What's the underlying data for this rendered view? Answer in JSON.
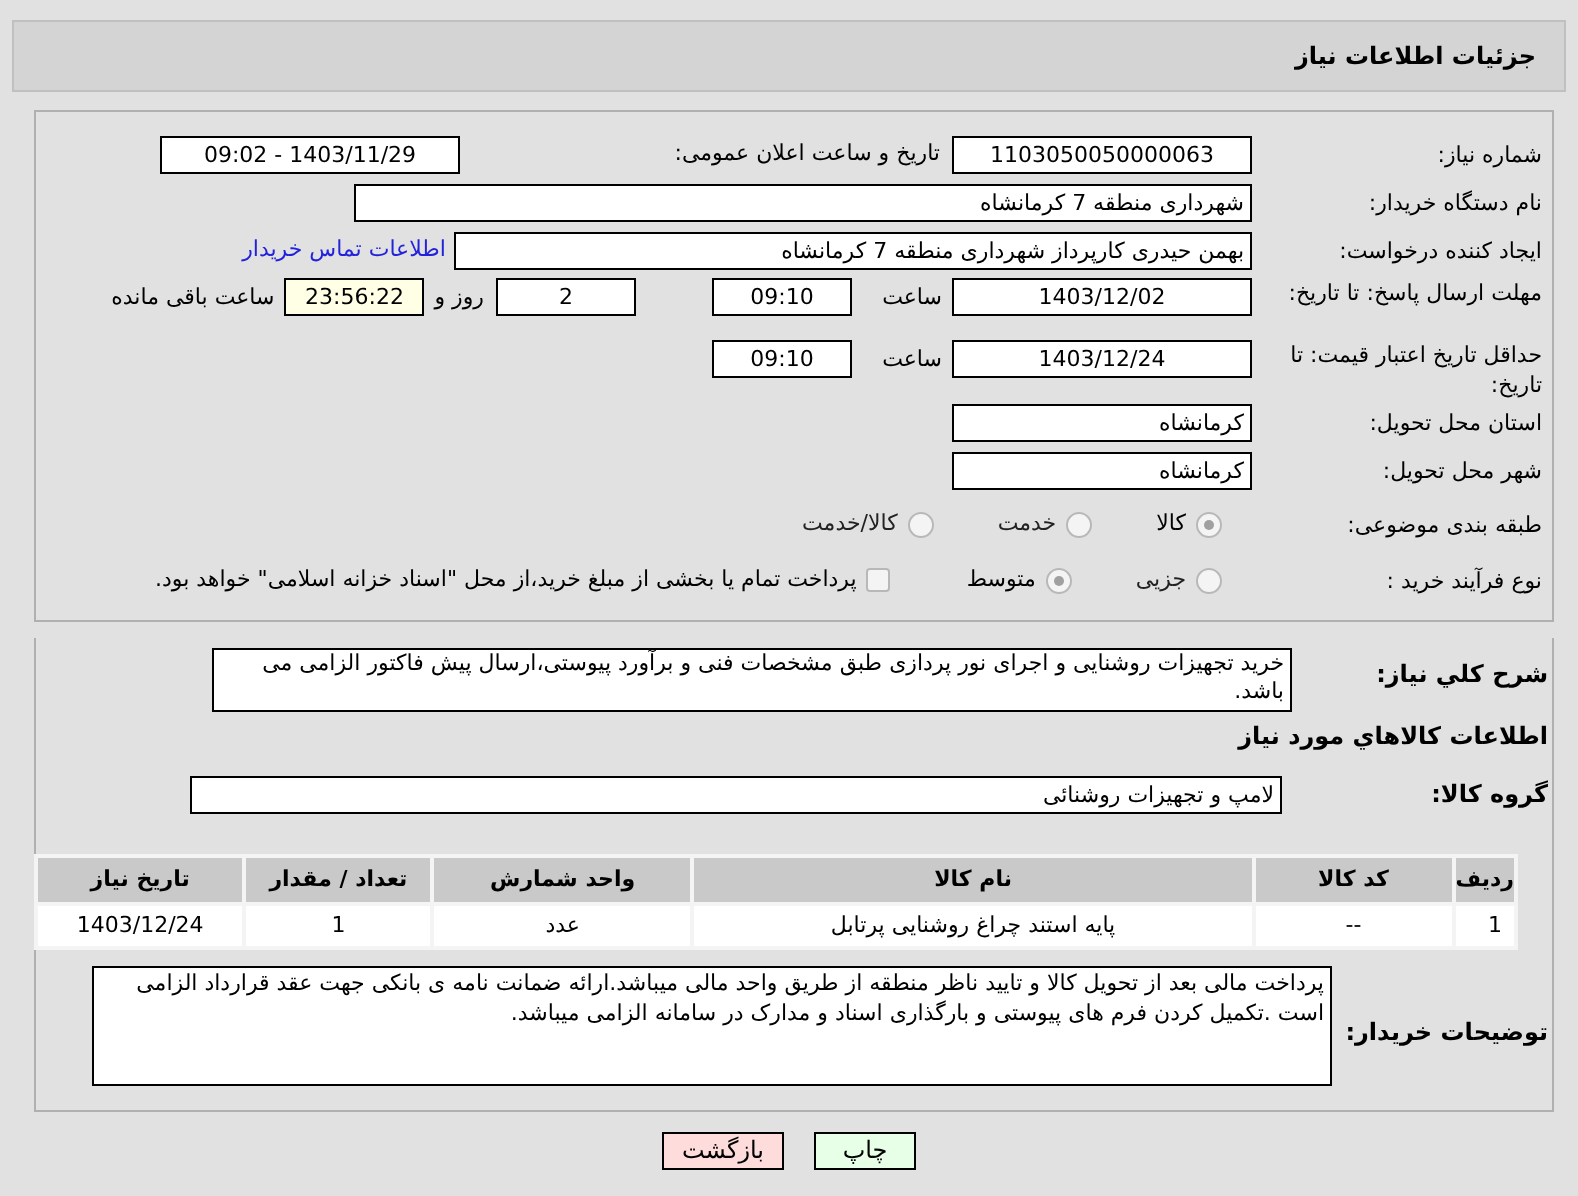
{
  "page_title": "جزئیات اطلاعات نیاز",
  "need_number": {
    "label": "شماره نیاز:",
    "value": "1103050050000063"
  },
  "announce": {
    "label": "تاریخ و ساعت اعلان عمومی:",
    "value": "1403/11/29 - 09:02"
  },
  "buyer_org": {
    "label": "نام دستگاه خریدار:",
    "value": "شهرداری منطقه 7 کرمانشاه"
  },
  "requester": {
    "label": "ایجاد کننده درخواست:",
    "value": "بهمن حیدری کارپرداز شهرداری منطقه 7 کرمانشاه",
    "link": "اطلاعات تماس خریدار"
  },
  "response_deadline": {
    "label": "مهلت ارسال پاسخ: تا تاریخ:",
    "date": "1403/12/02",
    "time_label": "ساعت",
    "time": "09:10",
    "days": "2",
    "days_label": "روز و",
    "remaining": "23:56:22",
    "remaining_label": "ساعت باقی مانده"
  },
  "price_validity": {
    "label": "حداقل تاریخ اعتبار قیمت: تا تاریخ:",
    "date": "1403/12/24",
    "time_label": "ساعت",
    "time": "09:10"
  },
  "province": {
    "label": "استان محل تحویل:",
    "value": "کرمانشاه"
  },
  "city": {
    "label": "شهر محل تحویل:",
    "value": "کرمانشاه"
  },
  "category": {
    "label": "طبقه بندی موضوعی:",
    "options": [
      {
        "label": "کالا",
        "selected": true
      },
      {
        "label": "خدمت",
        "selected": false
      },
      {
        "label": "کالا/خدمت",
        "selected": false
      }
    ]
  },
  "process": {
    "label": "نوع فرآیند خرید :",
    "options": [
      {
        "label": "جزیی",
        "selected": false
      },
      {
        "label": "متوسط",
        "selected": true
      }
    ],
    "payment": {
      "label": "پرداخت تمام یا بخشی از مبلغ خرید،از محل \"اسناد خزانه اسلامی\" خواهد بود.",
      "checked": false
    }
  },
  "description": {
    "label": "شرح کلي نياز:",
    "value": "خرید تجهیزات روشنایی و اجرای نور پردازی طبق مشخصات فنی و برآورد پیوستی،ارسال پیش فاکتور الزامی می باشد."
  },
  "goods_title": "اطلاعات کالاهاي مورد نياز",
  "goods_group": {
    "label": "گروه کالا:",
    "value": "لامپ و تجهیزات روشنائی"
  },
  "table": {
    "columns": [
      "ردیف",
      "کد کالا",
      "نام کالا",
      "واحد شمارش",
      "تعداد / مقدار",
      "تاریخ نیاز"
    ],
    "rows": [
      [
        "1",
        "--",
        "پایه استند چراغ روشنایی پرتابل",
        "عدد",
        "1",
        "1403/12/24"
      ]
    ]
  },
  "buyer_notes": {
    "label": "توضیحات خریدار:",
    "value": "پرداخت مالی بعد از تحویل کالا و تایید ناظر منطقه از طریق واحد مالی میباشد.ارائه ضمانت نامه ی بانکی جهت عقد قرارداد الزامی است .تکمیل کردن فرم های پیوستی و بارگذاری اسناد و مدارک در سامانه الزامی میباشد."
  },
  "buttons": [
    {
      "label": "چاپ",
      "kind": "print"
    },
    {
      "label": "بازگشت",
      "kind": "back"
    }
  ]
}
